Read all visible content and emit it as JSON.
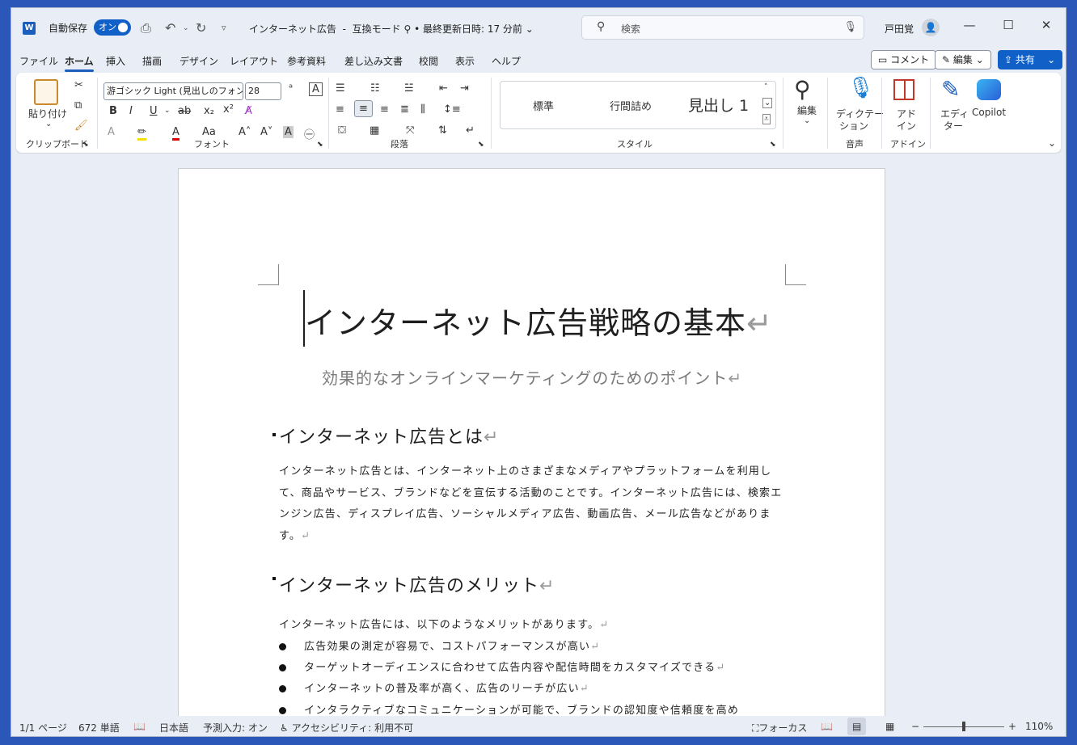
{
  "titlebar": {
    "app_icon": "W",
    "autosave_label": "自動保存",
    "autosave_toggle": "オン",
    "doc_title": "インターネット広告",
    "mode": "互換モード",
    "last_saved": "• 最終更新日時: 17 分前",
    "search_placeholder": "検索",
    "user_name": "戸田覚"
  },
  "menu": {
    "tabs": [
      "ファイル",
      "ホーム",
      "挿入",
      "描画",
      "デザイン",
      "レイアウト",
      "参考資料",
      "差し込み文書",
      "校閲",
      "表示",
      "ヘルプ"
    ],
    "active": "ホーム",
    "comment": "コメント",
    "edit": "編集",
    "share": "共有"
  },
  "ribbon": {
    "clipboard": {
      "paste": "貼り付け",
      "group": "クリップボード"
    },
    "font": {
      "font_name": "游ゴシック Light (見出しのフォン",
      "font_size": "28",
      "group": "フォント"
    },
    "paragraph": {
      "group": "段落"
    },
    "styles": {
      "items": [
        "標準",
        "行間詰め",
        "見出し 1"
      ],
      "group": "スタイル"
    },
    "editing": {
      "label": "編集"
    },
    "voice": {
      "label1": "ディクテー",
      "label2": "ション",
      "group": "音声"
    },
    "addins": {
      "label1": "アド",
      "label2": "イン",
      "group": "アドイン"
    },
    "editor": {
      "label1": "エディ",
      "label2": "ター"
    },
    "copilot": {
      "label": "Copilot"
    }
  },
  "document": {
    "title": "インターネット広告戦略の基本",
    "subtitle": "効果的なオンラインマーケティングのためのポイント",
    "heading1": "インターネット広告とは",
    "para1": "インターネット広告とは、インターネット上のさまざまなメディアやプラットフォームを利用して、商品やサービス、ブランドなどを宣伝する活動のことです。インターネット広告には、検索エンジン広告、ディスプレイ広告、ソーシャルメディア広告、動画広告、メール広告などがあります。",
    "heading2": "インターネット広告のメリット",
    "para2": "インターネット広告には、以下のようなメリットがあります。",
    "bullets": [
      "広告効果の測定が容易で、コストパフォーマンスが高い",
      "ターゲットオーディエンスに合わせて広告内容や配信時間をカスタマイズできる",
      "インターネットの普及率が高く、広告のリーチが広い",
      "インタラクティブなコミュニケーションが可能で、ブランドの認知度や信頼度を高め"
    ],
    "para_mark": "↵"
  },
  "status": {
    "page": "1/1 ページ",
    "words": "672 単語",
    "language": "日本語",
    "prediction": "予測入力: オン",
    "accessibility": "アクセシビリティ: 利用不可",
    "focus": "フォーカス",
    "zoom": "110%"
  }
}
